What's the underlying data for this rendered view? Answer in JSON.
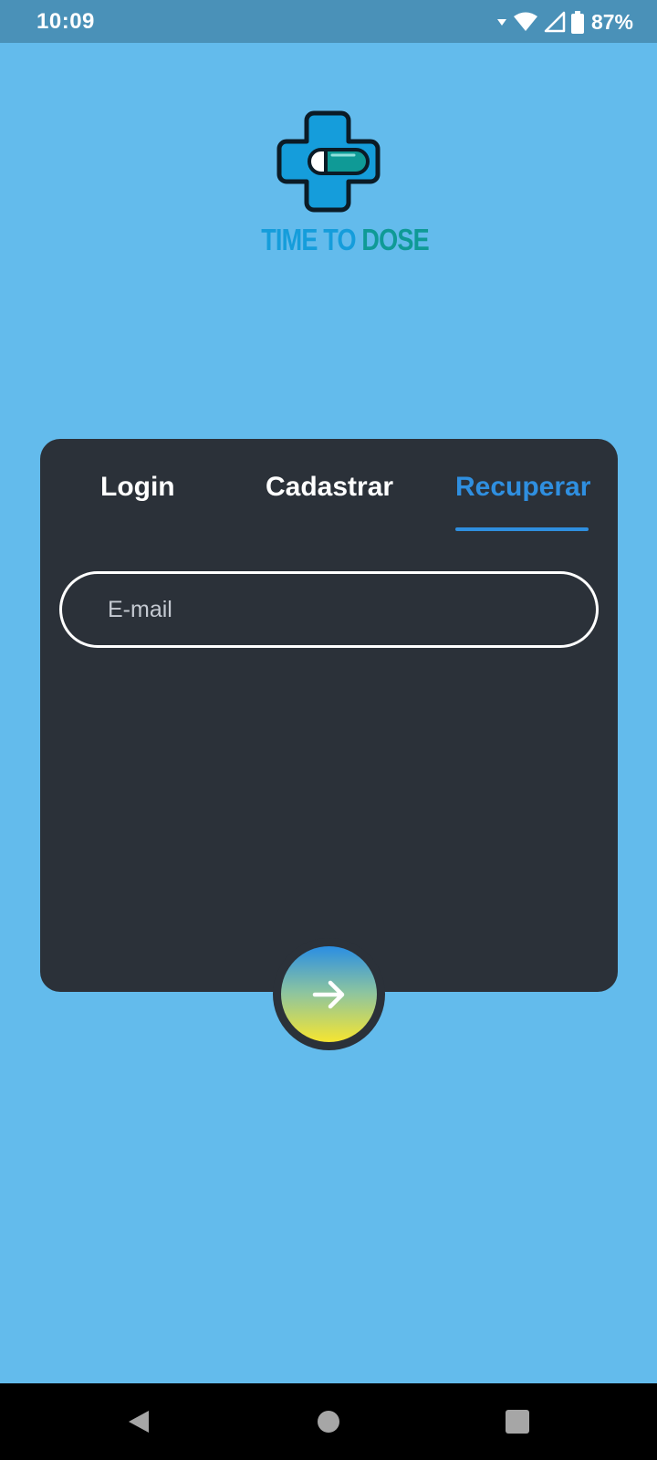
{
  "status_bar": {
    "time": "10:09",
    "battery_percent": "87%",
    "icons": [
      "data-arrow-icon",
      "wifi-icon",
      "signal-icon",
      "battery-icon"
    ]
  },
  "logo": {
    "word1": "TIME TO",
    "word2": "DOSE",
    "icon": "pill-cross-icon",
    "colors": {
      "blue": "#159ddb",
      "teal": "#0f9a96"
    }
  },
  "tabs": [
    {
      "label": "Login",
      "active": false
    },
    {
      "label": "Cadastrar",
      "active": false
    },
    {
      "label": "Recuperar",
      "active": true
    }
  ],
  "form": {
    "email_placeholder": "E-mail",
    "email_value": ""
  },
  "submit": {
    "icon": "arrow-right-icon"
  },
  "nav_bar": {
    "icons": [
      "back-icon",
      "home-icon",
      "recents-icon"
    ]
  },
  "colors": {
    "background": "#63bbec",
    "status_bar": "#4a91b8",
    "card": "#2b3139",
    "accent": "#2f8fe0",
    "button_gradient": [
      "#2a8ee3",
      "#f6e531"
    ]
  }
}
